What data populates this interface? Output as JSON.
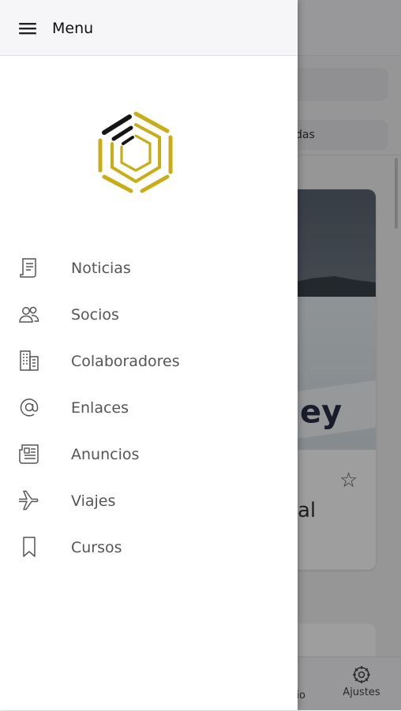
{
  "drawer": {
    "title": "Menu",
    "items": [
      {
        "label": "Noticias",
        "icon": "news-document-icon"
      },
      {
        "label": "Socios",
        "icon": "people-icon"
      },
      {
        "label": "Colaboradores",
        "icon": "buildings-icon"
      },
      {
        "label": "Enlaces",
        "icon": "at-sign-icon"
      },
      {
        "label": "Anuncios",
        "icon": "newspaper-icon"
      },
      {
        "label": "Viajes",
        "icon": "airplane-icon"
      },
      {
        "label": "Cursos",
        "icon": "bookmark-icon"
      }
    ]
  },
  "background": {
    "chip_partial": "das",
    "card_text_partial": "al",
    "card_image_text_partial": "ey",
    "tab_partial": "rio",
    "tab_settings_label": "Ajustes"
  },
  "colors": {
    "logo_gold": "#c9ad17",
    "logo_black": "#151515",
    "overlay": "rgba(0,0,0,0.38)"
  }
}
